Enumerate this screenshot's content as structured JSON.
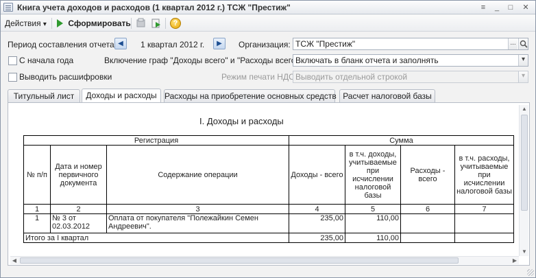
{
  "window": {
    "title": "Книга учета доходов и расходов (1 квартал 2012 г.) ТСЖ \"Престиж\"",
    "controls": {
      "menu": "≡",
      "minimize": "_",
      "maximize": "□",
      "close": "✕"
    }
  },
  "toolbar": {
    "actions_label": "Действия",
    "actions_arrow": "▾",
    "generate_label": "Сформировать",
    "help_label": "?"
  },
  "form": {
    "period_label": "Период составления отчета:",
    "period_prev": "◀",
    "period_value": "1 квартал 2012 г.",
    "period_next": "▶",
    "org_label": "Организация:",
    "org_value": "ТСЖ \"Престиж\"",
    "org_select_btn": "...",
    "org_search_btn": "🔍",
    "from_year_start_label": "С начала года",
    "include_columns_label": "Включение граф \"Доходы всего\" и \"Расходы всего\":",
    "include_columns_value": "Включать в бланк отчета и заполнять",
    "dropdown_arrow": "▾",
    "show_decode_label": "Выводить расшифровки",
    "vat_mode_label": "Режим печати НДС:",
    "vat_mode_value": "Выводить отдельной строкой"
  },
  "tabs": [
    {
      "label": "Титульный лист",
      "active": false
    },
    {
      "label": "Доходы и расходы",
      "active": true
    },
    {
      "label": "Расходы на приобретение основных средств",
      "active": false
    },
    {
      "label": "Расчет налоговой базы",
      "active": false
    }
  ],
  "report": {
    "title": "I. Доходы и расходы",
    "group_headers": {
      "registration": "Регистрация",
      "sum": "Сумма"
    },
    "columns": [
      "№ п/п",
      "Дата и номер первичного документа",
      "Содержание операции",
      "Доходы - всего",
      "в т.ч. доходы, учитываемые при исчислении налоговой базы",
      "Расходы - всего",
      "в т.ч. расходы, учитываемые при исчислении налоговой базы"
    ],
    "column_numbers": [
      "1",
      "2",
      "3",
      "4",
      "5",
      "6",
      "7"
    ],
    "rows": [
      {
        "num": "1",
        "doc": "№ 3 от 02.03.2012",
        "content": "Оплата от покупателя \"Полежайкин Семен Андреевич\".",
        "income_total": "235,00",
        "income_taxable": "110,00",
        "expense_total": "",
        "expense_taxable": ""
      }
    ],
    "total": {
      "label": "Итого за I квартал",
      "income_total": "235,00",
      "income_taxable": "110,00",
      "expense_total": "",
      "expense_taxable": ""
    }
  },
  "scrollbars": {
    "up": "▲",
    "down": "▼",
    "left": "◀",
    "right": "▶"
  }
}
